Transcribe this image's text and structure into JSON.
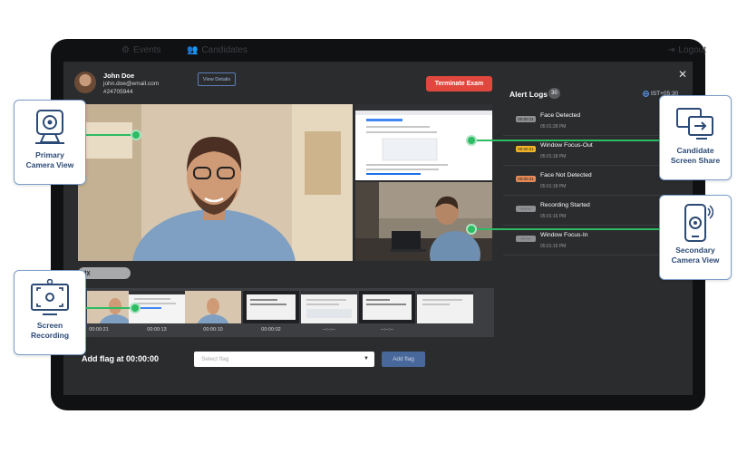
{
  "nav": {
    "events_label": "Events",
    "candidates_label": "Candidates",
    "logout_label": "Logout"
  },
  "candidate": {
    "name": "John Doe",
    "email": "john.doe@email.com",
    "id": "#24705944",
    "view_details_label": "View Details"
  },
  "terminate_label": "Terminate Exam",
  "alerts": {
    "title": "Alert Logs",
    "count": "30",
    "timezone": "IST+05:30",
    "items": [
      {
        "badge": "00:00:11",
        "badge_color": "#8e8f92",
        "label": "Face Detected",
        "time": "05:01:28 PM"
      },
      {
        "badge": "00:00:21",
        "badge_color": "#f0b429",
        "label": "Window Focus-Out",
        "time": "05:01:18 PM"
      },
      {
        "badge": "00:00:21",
        "badge_color": "#e58a57",
        "label": "Face Not Detected",
        "time": "05:01:18 PM"
      },
      {
        "badge": "--:--:--",
        "badge_color": "#8e8f92",
        "label": "Recording Started",
        "time": "05:01:16 PM"
      },
      {
        "badge": "--:--:--",
        "badge_color": "#8e8f92",
        "label": "Window Focus-In",
        "time": "05:01:15 PM"
      }
    ]
  },
  "timeline": {
    "times": [
      "00:00:21",
      "00:00:13",
      "00:00:10",
      "00:00:02",
      "--:--:--",
      "--:--:--"
    ]
  },
  "flag": {
    "label": "Add flag at 00:00:00",
    "placeholder": "Select flag",
    "button_label": "Add flag"
  },
  "callouts": {
    "primary_label": "Primary Camera View",
    "screen_share_label": "Candidate Screen Share",
    "screen_recording_label": "Screen Recording",
    "secondary_label": "Secondary Camera View"
  },
  "colors": {
    "accent_green": "#2dbb63",
    "terminate_red": "#e0483e",
    "callout_border": "#7d9fc9",
    "callout_text": "#2c4a76"
  },
  "icons": [
    "webcam-icon",
    "screen-share-icon",
    "screen-recording-icon",
    "phone-camera-icon",
    "close-icon",
    "globe-icon",
    "chevron-down-icon",
    "mute-icon"
  ]
}
